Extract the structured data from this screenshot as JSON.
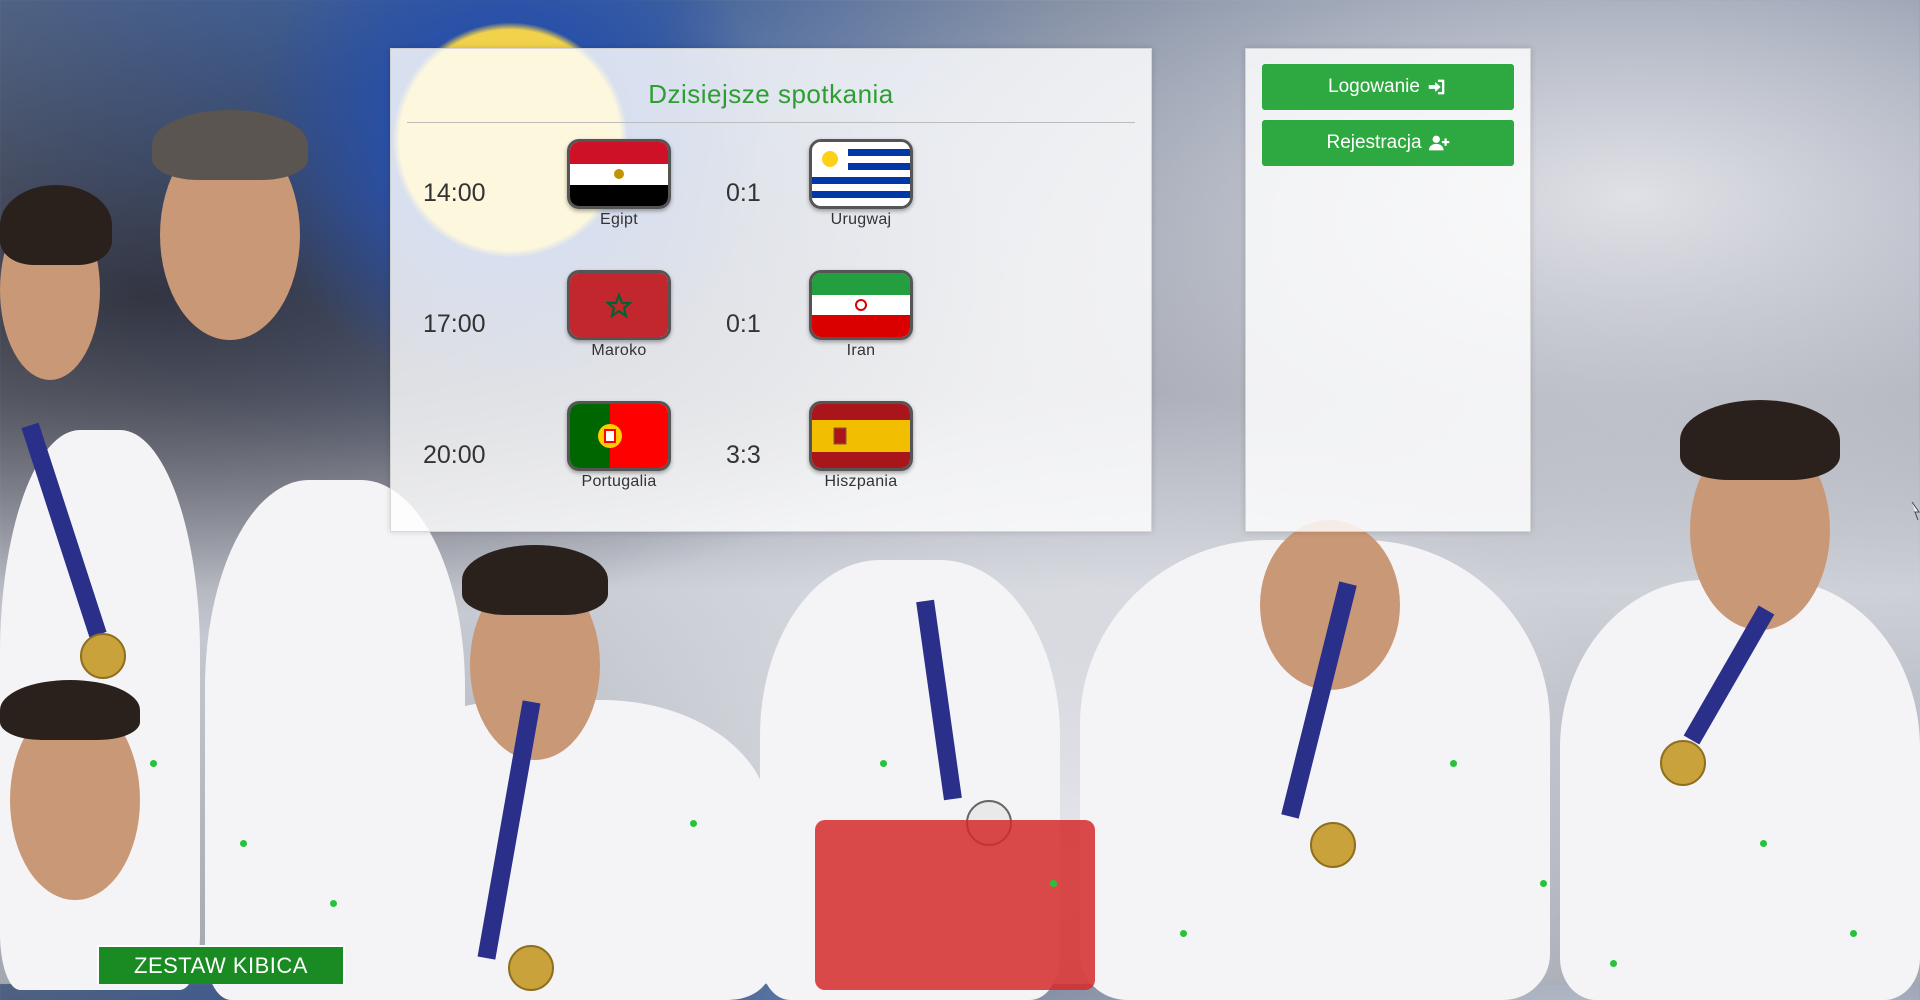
{
  "matches": {
    "title": "Dzisiejsze spotkania",
    "items": [
      {
        "time": "14:00",
        "home": "Egipt",
        "score": "0:1",
        "away": "Urugwaj",
        "home_flag": "egypt-flag",
        "away_flag": "uruguay-flag"
      },
      {
        "time": "17:00",
        "home": "Maroko",
        "score": "0:1",
        "away": "Iran",
        "home_flag": "morocco-flag",
        "away_flag": "iran-flag"
      },
      {
        "time": "20:00",
        "home": "Portugalia",
        "score": "3:3",
        "away": "Hiszpania",
        "home_flag": "portugal-flag",
        "away_flag": "spain-flag"
      }
    ]
  },
  "auth": {
    "login_label": "Logowanie",
    "login_icon": "sign-in-icon",
    "register_label": "Rejestracja",
    "register_icon": "user-plus-icon"
  },
  "footer": {
    "supporter_kit_label": "ZESTAW KIBICA"
  },
  "colors": {
    "accent_green": "#2ea941",
    "title_green": "#2e9e32",
    "supporter_green": "#1a8a23"
  }
}
